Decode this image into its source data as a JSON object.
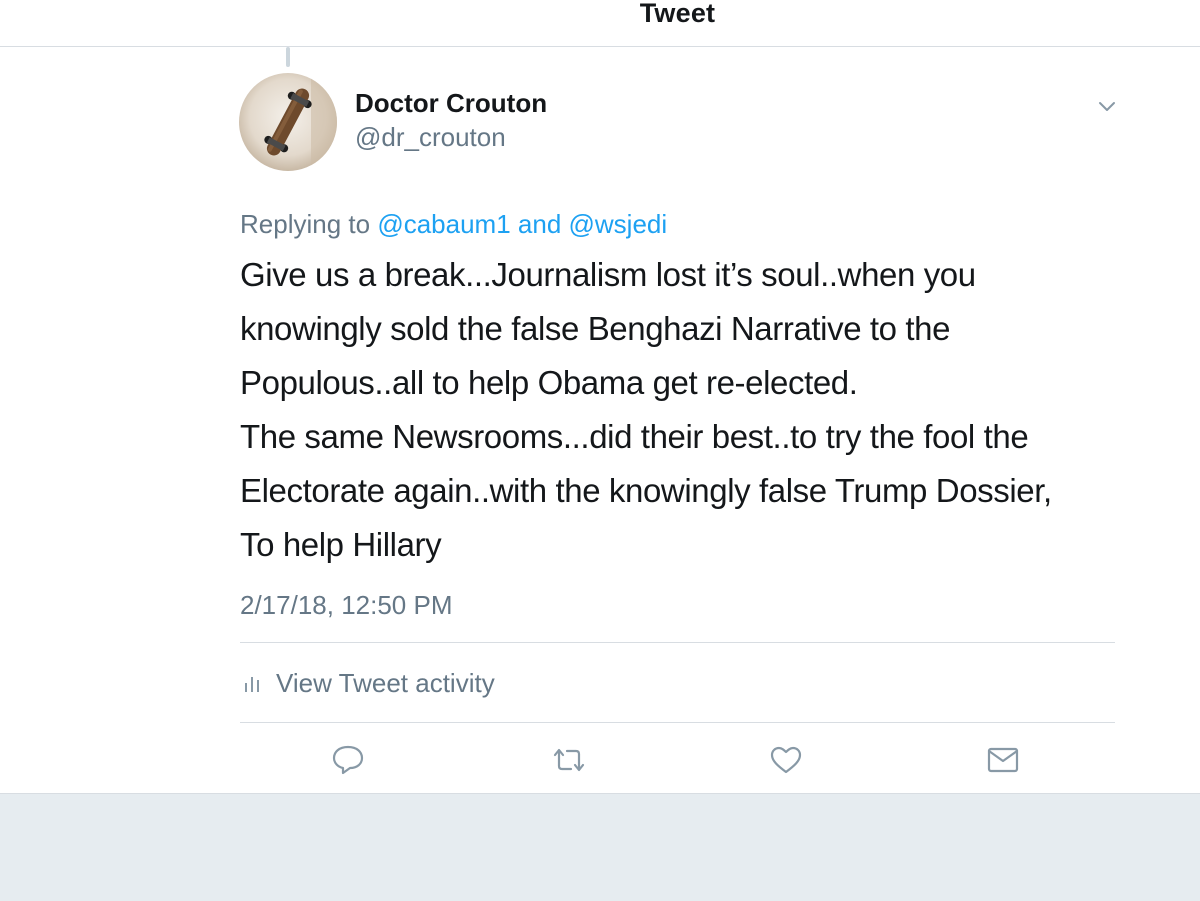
{
  "nav": {
    "title": "Tweet"
  },
  "tweet": {
    "display_name": "Doctor Crouton",
    "handle": "@dr_crouton",
    "replying_prefix": "Replying to ",
    "replying_to_1": "@cabaum1",
    "replying_and": " and ",
    "replying_to_2": "@wsjedi",
    "text": "Give us a break...Journalism lost it’s soul..when you\nknowingly sold the false Benghazi Narrative to the\nPopulous..all to help Obama get re-elected.\nThe same Newsrooms...did their best..to try the fool the\nElectorate again..with the knowingly false Trump Dossier,\nTo help Hillary",
    "timestamp": "2/17/18, 12:50 PM",
    "activity_label": "View Tweet activity"
  },
  "icons": {
    "caret": "chevron-down-icon",
    "activity": "bar-chart-icon",
    "reply": "reply-icon",
    "retweet": "retweet-icon",
    "like": "heart-icon",
    "dm": "envelope-icon"
  },
  "colors": {
    "text_primary": "#14171a",
    "text_secondary": "#657786",
    "link": "#1da1f2",
    "divider": "#d8dde2",
    "background_bottom": "#e6ecf0"
  }
}
